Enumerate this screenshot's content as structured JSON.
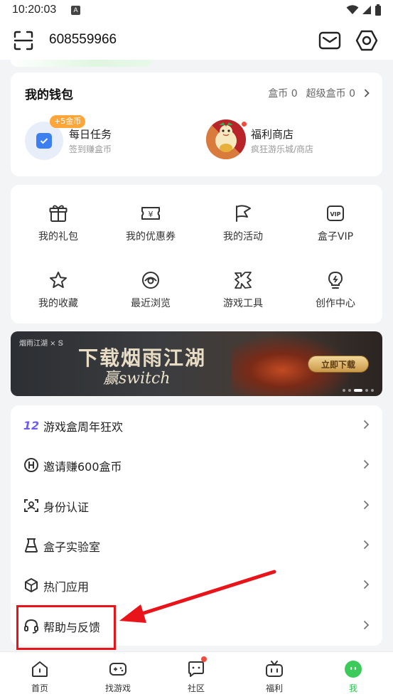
{
  "status_bar": {
    "time": "10:20:03",
    "indicator": "A",
    "icons": [
      "wifi-icon",
      "signal-icon",
      "battery-icon"
    ]
  },
  "header": {
    "user_id": "608559966",
    "icons": [
      "scan-icon",
      "mail-icon",
      "settings-icon"
    ]
  },
  "wallet": {
    "title": "我的钱包",
    "coins_label": "盒币 0",
    "super_coins_label": "超级盒币 0",
    "daily_task": {
      "badge": "+5金币",
      "name": "每日任务",
      "subtitle": "签到赚盒币"
    },
    "store": {
      "name": "福利商店",
      "subtitle": "疯狂游乐城/商店"
    }
  },
  "features": [
    {
      "label": "我的礼包",
      "icon": "gift-icon"
    },
    {
      "label": "我的优惠券",
      "icon": "coupon-icon"
    },
    {
      "label": "我的活动",
      "icon": "flag-icon"
    },
    {
      "label": "盒子VIP",
      "icon": "vip-icon"
    },
    {
      "label": "我的收藏",
      "icon": "star-icon"
    },
    {
      "label": "最近浏览",
      "icon": "eye-icon"
    },
    {
      "label": "游戏工具",
      "icon": "tools-icon"
    },
    {
      "label": "创作中心",
      "icon": "lightbulb-icon"
    }
  ],
  "banner": {
    "logo_text": "烟雨江湖 × 𝕊",
    "headline": "下载烟雨江湖",
    "subline": "赢switch",
    "button": "立即下载",
    "slide_count": 5,
    "active_slide": 3
  },
  "menu": [
    {
      "label": "游戏盒周年狂欢",
      "icon": "anniversary-icon"
    },
    {
      "label": "邀请赚600盒币",
      "icon": "invite-coin-icon"
    },
    {
      "label": "身份认证",
      "icon": "id-verify-icon"
    },
    {
      "label": "盒子实验室",
      "icon": "lab-flask-icon"
    },
    {
      "label": "热门应用",
      "icon": "cube-icon"
    },
    {
      "label": "帮助与反馈",
      "icon": "headset-icon"
    }
  ],
  "tabs": [
    {
      "label": "首页",
      "icon": "home-icon"
    },
    {
      "label": "找游戏",
      "icon": "gamepad-icon"
    },
    {
      "label": "社区",
      "icon": "chat-icon"
    },
    {
      "label": "福利",
      "icon": "gift-tv-icon"
    },
    {
      "label": "我",
      "icon": "profile-face-icon"
    }
  ],
  "colors": {
    "accent": "#2fbf4f",
    "annotation": "#e8141a",
    "badge": "#ffa63a",
    "notify_dot": "#f24a3d"
  }
}
